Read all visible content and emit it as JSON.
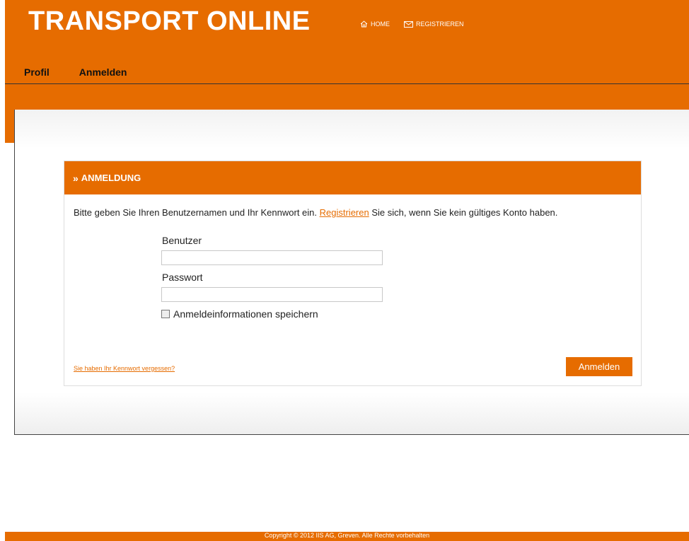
{
  "header": {
    "brand": "TRANSPORT ONLINE",
    "top_nav": [
      {
        "label": "HOME",
        "icon": "home-icon"
      },
      {
        "label": "REGISTRIEREN",
        "icon": "mail-icon"
      }
    ],
    "main_nav": [
      {
        "label": "Profil"
      },
      {
        "label": "Anmelden"
      }
    ]
  },
  "login": {
    "title": "ANMELDUNG",
    "intro_before": "Bitte geben Sie Ihren Benutzernamen und Ihr Kennwort ein. ",
    "intro_link": "Registrieren",
    "intro_after": " Sie sich, wenn Sie kein gültiges Konto haben.",
    "username_label": "Benutzer",
    "username_value": "",
    "password_label": "Passwort",
    "password_value": "",
    "remember_label": "Anmeldeinformationen speichern",
    "remember_checked": false,
    "forgot_link": "Sie haben Ihr Kennwort vergessen?",
    "submit_label": "Anmelden"
  },
  "footer": {
    "copyright": "Copyright © 2012 IIS AG, Greven. Alle Rechte vorbehalten"
  },
  "colors": {
    "accent": "#e66c00",
    "background": "#ffffff",
    "text": "#222222"
  }
}
